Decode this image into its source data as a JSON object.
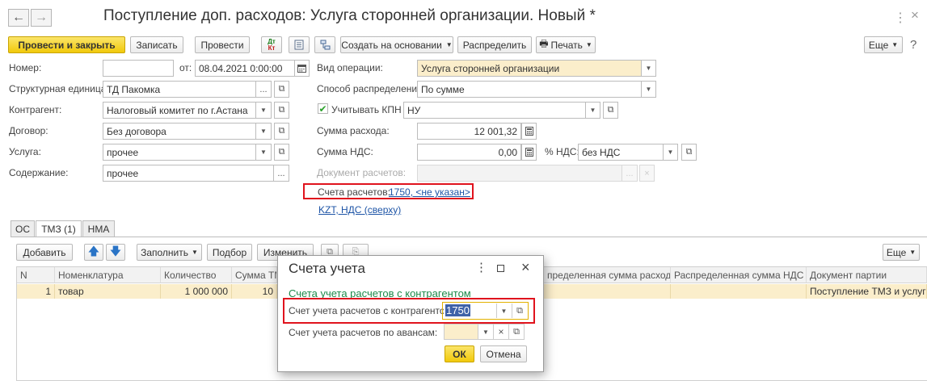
{
  "window": {
    "title": "Поступление доп. расходов: Услуга сторонней организации. Новый *"
  },
  "toolbar": {
    "post_close": "Провести и закрыть",
    "save": "Записать",
    "post": "Провести",
    "dtkt": "Дт Кт",
    "create_based": "Создать на основании",
    "distribute": "Распределить",
    "print": "Печать",
    "more": "Еще"
  },
  "form": {
    "number_label": "Номер:",
    "number_value": "",
    "from_label": "от:",
    "date_value": "08.04.2021  0:00:00",
    "unit_label": "Структурная единица:",
    "unit_value": "ТД Пакомка",
    "contractor_label": "Контрагент:",
    "contractor_value": "Налоговый комитет по г.Астана",
    "contract_label": "Договор:",
    "contract_value": "Без договора",
    "service_label": "Услуга:",
    "service_value": "прочее",
    "content_label": "Содержание:",
    "content_value": "прочее",
    "operation_label": "Вид операции:",
    "operation_value": "Услуга сторонней организации",
    "distribution_label": "Способ распределения:",
    "distribution_value": "По сумме",
    "kpn_label": "Учитывать КПН",
    "kpn_value": "НУ",
    "expense_label": "Сумма расхода:",
    "expense_value": "12 001,32",
    "vat_sum_label": "Сумма НДС:",
    "vat_sum_value": "0,00",
    "vat_rate_label": "% НДС:",
    "vat_rate_value": "без НДС",
    "payment_doc_label": "Документ расчетов:",
    "accounts_label": "Счета расчетов:",
    "accounts_link": "1750, <не указан>",
    "currency_link": "KZT, НДС (сверху)"
  },
  "tabs": [
    {
      "label": "ОС"
    },
    {
      "label": "ТМЗ (1)"
    },
    {
      "label": "НМА"
    }
  ],
  "table_toolbar": {
    "add": "Добавить",
    "fill": "Заполнить",
    "select": "Подбор",
    "change": "Изменить",
    "more": "Еще"
  },
  "table": {
    "headers": [
      "N",
      "Номенклатура",
      "Количество",
      "Сумма ТМ",
      "",
      "пределенная сумма расходов",
      "Распределенная сумма НДС",
      "Документ партии"
    ],
    "rows": [
      [
        "1",
        "товар",
        "1 000 000",
        "10",
        "",
        "",
        "",
        "Поступление ТМЗ и услуг ..."
      ]
    ]
  },
  "dialog": {
    "title": "Счета учета",
    "section": "Счета учета расчетов с контрагентом",
    "field1_label": "Счет учета расчетов с контрагентом:",
    "field1_value": "1750",
    "field2_label": "Счет учета расчетов по авансам:",
    "field2_value": "",
    "ok": "ОК",
    "cancel": "Отмена"
  },
  "colors": {
    "primary_button": "#f1c90b",
    "highlight": "#e0131d",
    "link": "#1d54a6",
    "selected_row": "#fbeecb"
  }
}
